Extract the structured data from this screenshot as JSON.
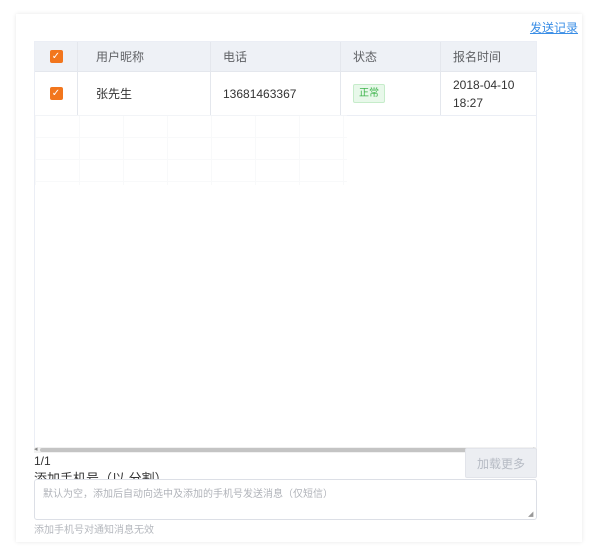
{
  "header": {
    "send_record_link": "发送记录"
  },
  "table": {
    "columns": [
      "用户昵称",
      "电话",
      "状态",
      "报名时间"
    ],
    "rows": [
      {
        "nickname": "张先生",
        "phone": "13681463367",
        "status": "正常",
        "signup_time": "2018-04-10 18:27",
        "checked": true
      }
    ],
    "header_checkbox_checked": true
  },
  "footer": {
    "page_count": "1/1",
    "add_phone_label": "添加手机号（以,分割）",
    "load_more_button": "加载更多",
    "textarea_placeholder": "默认为空，添加后自动向选中及添加的手机号发送消息（仅短信）",
    "hint": "添加手机号对通知消息无效"
  },
  "colors": {
    "accent_checkbox": "#f2761d",
    "link": "#3a8ee6",
    "status_green": "#3cb34a"
  },
  "icons": {
    "checkbox": "check-mark",
    "scroll_left": "arrow-left",
    "scroll_right": "arrow-right",
    "resize": "resize-grip"
  }
}
